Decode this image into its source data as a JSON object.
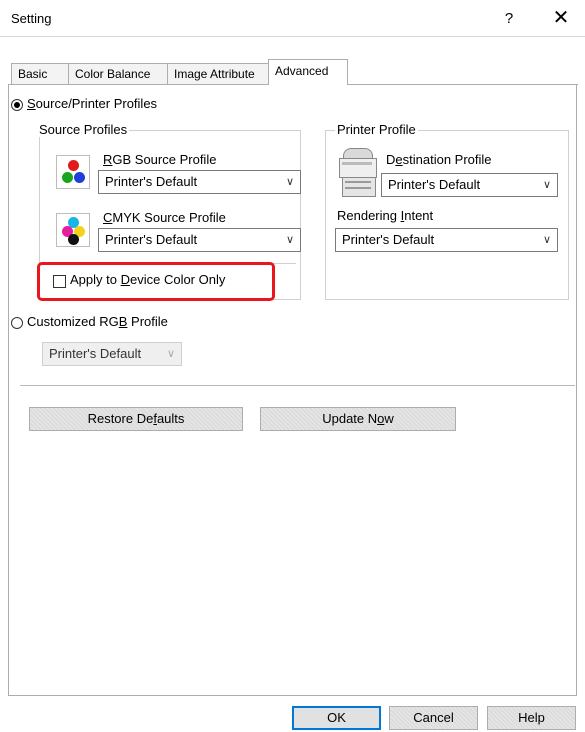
{
  "window": {
    "title": "Setting",
    "help_glyph": "?",
    "close_glyph": "✕"
  },
  "tabs": [
    {
      "label": "Basic"
    },
    {
      "label": "Color Balance"
    },
    {
      "label": "Image Attribute"
    },
    {
      "label": "Advanced"
    }
  ],
  "active_tab": "Advanced",
  "source_printer_profiles": {
    "radio_label_u": "S",
    "radio_label_rest": "ource/Printer Profiles",
    "checked": true
  },
  "source_profiles_group": {
    "title": "Source Profiles",
    "rgb": {
      "label_u": "R",
      "label_rest": "GB Source Profile",
      "value": "Printer's Default"
    },
    "cmyk": {
      "label_u": "C",
      "label_rest": "MYK Source Profile",
      "value": "Printer's Default"
    },
    "apply_device": {
      "label_pre": "Apply to ",
      "label_u": "D",
      "label_rest": "evice Color Only",
      "checked": false
    }
  },
  "printer_profile_group": {
    "title": "Printer Profile",
    "destination": {
      "label_pre": "D",
      "label_u": "e",
      "label_rest": "stination Profile",
      "value": "Printer's Default"
    },
    "rendering": {
      "label_pre": "Rendering ",
      "label_u": "I",
      "label_rest": "ntent",
      "value": "Printer's Default"
    }
  },
  "customized_rgb": {
    "label_pre": "Customized RG",
    "label_u": "B",
    "label_rest": " Profile",
    "checked": false,
    "value": "Printer's Default"
  },
  "buttons": {
    "restore_pre": "Restore De",
    "restore_u": "f",
    "restore_rest": "aults",
    "update_pre": "Update N",
    "update_u": "o",
    "update_rest": "w",
    "ok": "OK",
    "cancel": "Cancel",
    "help": "Help"
  },
  "colors": {
    "highlight": "#e8161d",
    "default_button_border": "#0078d7"
  }
}
